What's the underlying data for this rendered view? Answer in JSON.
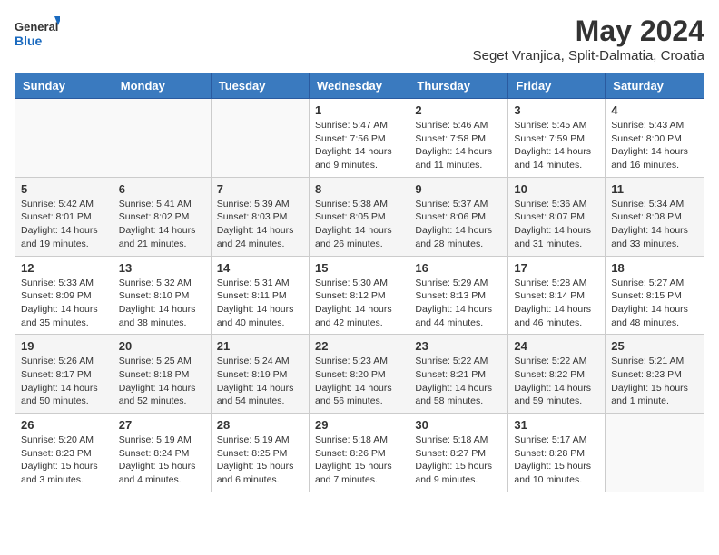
{
  "header": {
    "logo_general": "General",
    "logo_blue": "Blue",
    "title": "May 2024",
    "subtitle": "Seget Vranjica, Split-Dalmatia, Croatia"
  },
  "calendar": {
    "days_of_week": [
      "Sunday",
      "Monday",
      "Tuesday",
      "Wednesday",
      "Thursday",
      "Friday",
      "Saturday"
    ],
    "weeks": [
      [
        {
          "day": "",
          "info": ""
        },
        {
          "day": "",
          "info": ""
        },
        {
          "day": "",
          "info": ""
        },
        {
          "day": "1",
          "info": "Sunrise: 5:47 AM\nSunset: 7:56 PM\nDaylight: 14 hours\nand 9 minutes."
        },
        {
          "day": "2",
          "info": "Sunrise: 5:46 AM\nSunset: 7:58 PM\nDaylight: 14 hours\nand 11 minutes."
        },
        {
          "day": "3",
          "info": "Sunrise: 5:45 AM\nSunset: 7:59 PM\nDaylight: 14 hours\nand 14 minutes."
        },
        {
          "day": "4",
          "info": "Sunrise: 5:43 AM\nSunset: 8:00 PM\nDaylight: 14 hours\nand 16 minutes."
        }
      ],
      [
        {
          "day": "5",
          "info": "Sunrise: 5:42 AM\nSunset: 8:01 PM\nDaylight: 14 hours\nand 19 minutes."
        },
        {
          "day": "6",
          "info": "Sunrise: 5:41 AM\nSunset: 8:02 PM\nDaylight: 14 hours\nand 21 minutes."
        },
        {
          "day": "7",
          "info": "Sunrise: 5:39 AM\nSunset: 8:03 PM\nDaylight: 14 hours\nand 24 minutes."
        },
        {
          "day": "8",
          "info": "Sunrise: 5:38 AM\nSunset: 8:05 PM\nDaylight: 14 hours\nand 26 minutes."
        },
        {
          "day": "9",
          "info": "Sunrise: 5:37 AM\nSunset: 8:06 PM\nDaylight: 14 hours\nand 28 minutes."
        },
        {
          "day": "10",
          "info": "Sunrise: 5:36 AM\nSunset: 8:07 PM\nDaylight: 14 hours\nand 31 minutes."
        },
        {
          "day": "11",
          "info": "Sunrise: 5:34 AM\nSunset: 8:08 PM\nDaylight: 14 hours\nand 33 minutes."
        }
      ],
      [
        {
          "day": "12",
          "info": "Sunrise: 5:33 AM\nSunset: 8:09 PM\nDaylight: 14 hours\nand 35 minutes."
        },
        {
          "day": "13",
          "info": "Sunrise: 5:32 AM\nSunset: 8:10 PM\nDaylight: 14 hours\nand 38 minutes."
        },
        {
          "day": "14",
          "info": "Sunrise: 5:31 AM\nSunset: 8:11 PM\nDaylight: 14 hours\nand 40 minutes."
        },
        {
          "day": "15",
          "info": "Sunrise: 5:30 AM\nSunset: 8:12 PM\nDaylight: 14 hours\nand 42 minutes."
        },
        {
          "day": "16",
          "info": "Sunrise: 5:29 AM\nSunset: 8:13 PM\nDaylight: 14 hours\nand 44 minutes."
        },
        {
          "day": "17",
          "info": "Sunrise: 5:28 AM\nSunset: 8:14 PM\nDaylight: 14 hours\nand 46 minutes."
        },
        {
          "day": "18",
          "info": "Sunrise: 5:27 AM\nSunset: 8:15 PM\nDaylight: 14 hours\nand 48 minutes."
        }
      ],
      [
        {
          "day": "19",
          "info": "Sunrise: 5:26 AM\nSunset: 8:17 PM\nDaylight: 14 hours\nand 50 minutes."
        },
        {
          "day": "20",
          "info": "Sunrise: 5:25 AM\nSunset: 8:18 PM\nDaylight: 14 hours\nand 52 minutes."
        },
        {
          "day": "21",
          "info": "Sunrise: 5:24 AM\nSunset: 8:19 PM\nDaylight: 14 hours\nand 54 minutes."
        },
        {
          "day": "22",
          "info": "Sunrise: 5:23 AM\nSunset: 8:20 PM\nDaylight: 14 hours\nand 56 minutes."
        },
        {
          "day": "23",
          "info": "Sunrise: 5:22 AM\nSunset: 8:21 PM\nDaylight: 14 hours\nand 58 minutes."
        },
        {
          "day": "24",
          "info": "Sunrise: 5:22 AM\nSunset: 8:22 PM\nDaylight: 14 hours\nand 59 minutes."
        },
        {
          "day": "25",
          "info": "Sunrise: 5:21 AM\nSunset: 8:23 PM\nDaylight: 15 hours\nand 1 minute."
        }
      ],
      [
        {
          "day": "26",
          "info": "Sunrise: 5:20 AM\nSunset: 8:23 PM\nDaylight: 15 hours\nand 3 minutes."
        },
        {
          "day": "27",
          "info": "Sunrise: 5:19 AM\nSunset: 8:24 PM\nDaylight: 15 hours\nand 4 minutes."
        },
        {
          "day": "28",
          "info": "Sunrise: 5:19 AM\nSunset: 8:25 PM\nDaylight: 15 hours\nand 6 minutes."
        },
        {
          "day": "29",
          "info": "Sunrise: 5:18 AM\nSunset: 8:26 PM\nDaylight: 15 hours\nand 7 minutes."
        },
        {
          "day": "30",
          "info": "Sunrise: 5:18 AM\nSunset: 8:27 PM\nDaylight: 15 hours\nand 9 minutes."
        },
        {
          "day": "31",
          "info": "Sunrise: 5:17 AM\nSunset: 8:28 PM\nDaylight: 15 hours\nand 10 minutes."
        },
        {
          "day": "",
          "info": ""
        }
      ]
    ]
  }
}
